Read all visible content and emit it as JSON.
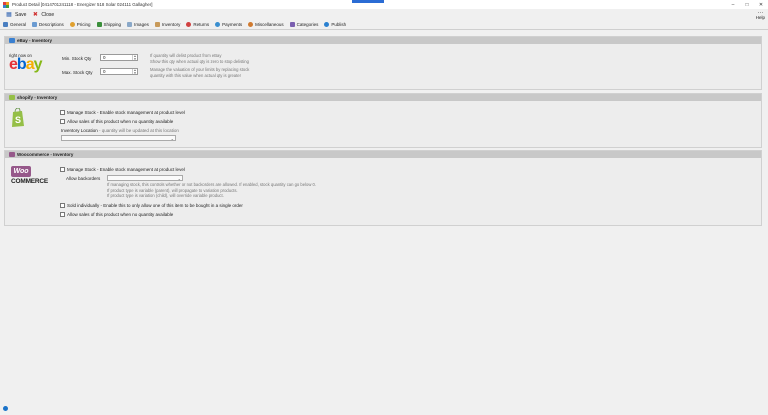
{
  "window": {
    "title": "Product Detail [0414701241118 - Energizer 518 Solar 024111 Gallagher]",
    "help_label": "Help",
    "drag_color": "#2b6cd4"
  },
  "toolbar": {
    "save_label": "Save",
    "close_label": "Close"
  },
  "tabs": [
    {
      "label": "General",
      "icon": "general-icon",
      "color": "#4a7fc1"
    },
    {
      "label": "Descriptions",
      "icon": "descriptions-icon",
      "color": "#6b9bd1"
    },
    {
      "label": "Pricing",
      "icon": "pricing-icon",
      "color": "#e0a030"
    },
    {
      "label": "Shipping",
      "icon": "shipping-icon",
      "color": "#3b8f3b"
    },
    {
      "label": "Images",
      "icon": "images-icon",
      "color": "#8aa8c8"
    },
    {
      "label": "Inventory",
      "icon": "inventory-icon",
      "color": "#c89a5a"
    },
    {
      "label": "Returns",
      "icon": "returns-icon",
      "color": "#d04040"
    },
    {
      "label": "Payments",
      "icon": "payments-icon",
      "color": "#3a8fd0"
    },
    {
      "label": "Miscellaneous",
      "icon": "miscellaneous-icon",
      "color": "#d07a30"
    },
    {
      "label": "Categories",
      "icon": "categories-icon",
      "color": "#7a5fb0"
    },
    {
      "label": "Publish",
      "icon": "publish-icon",
      "color": "#2a80d0"
    }
  ],
  "ebay": {
    "header": "eBay - Inventory",
    "logo_tagline": "right now on",
    "min_label": "Min. Stock Qty",
    "min_value": "0",
    "max_label": "Max. Stock Qty",
    "max_value": "0",
    "note1_a": "If quantity will delist product from eBay",
    "note1_b": "Show this qty when actual qty is zero to stop delisting",
    "note2_a": "Manage the valuation of your limits by replacing stock",
    "note2_b": "quantity with this value when actual qty is greater"
  },
  "shopify": {
    "header": "shopify - Inventory",
    "manage_stock": "Manage Stock - Enable stock management at product level",
    "allow_sales": "Allow sales of this product when no quantity available",
    "location_label": "Inventory Location",
    "location_hint": "- quantity will be updated at this location",
    "location_value": ""
  },
  "woo": {
    "header": "Woocommerce - Inventory",
    "badge": "Woo",
    "wordmark": "COMMERCE",
    "manage_stock": "Manage Stock - Enable stock management at product level",
    "allow_backorders_label": "Allow backorders",
    "allow_backorders_value": "",
    "note_1": "If managing stock, this controls whether or not backorders are allowed. If enabled, stock quantity can go below 0.",
    "note_2": "If product type is variable (parent), will propagate to variation products.",
    "note_3": "If product type is variation (child), will override variable product.",
    "sold_individually": "Sold individually - Enable this to only allow one of this item to be bought in a single order",
    "allow_sales": "Allow sales of this product when no quantity available"
  }
}
